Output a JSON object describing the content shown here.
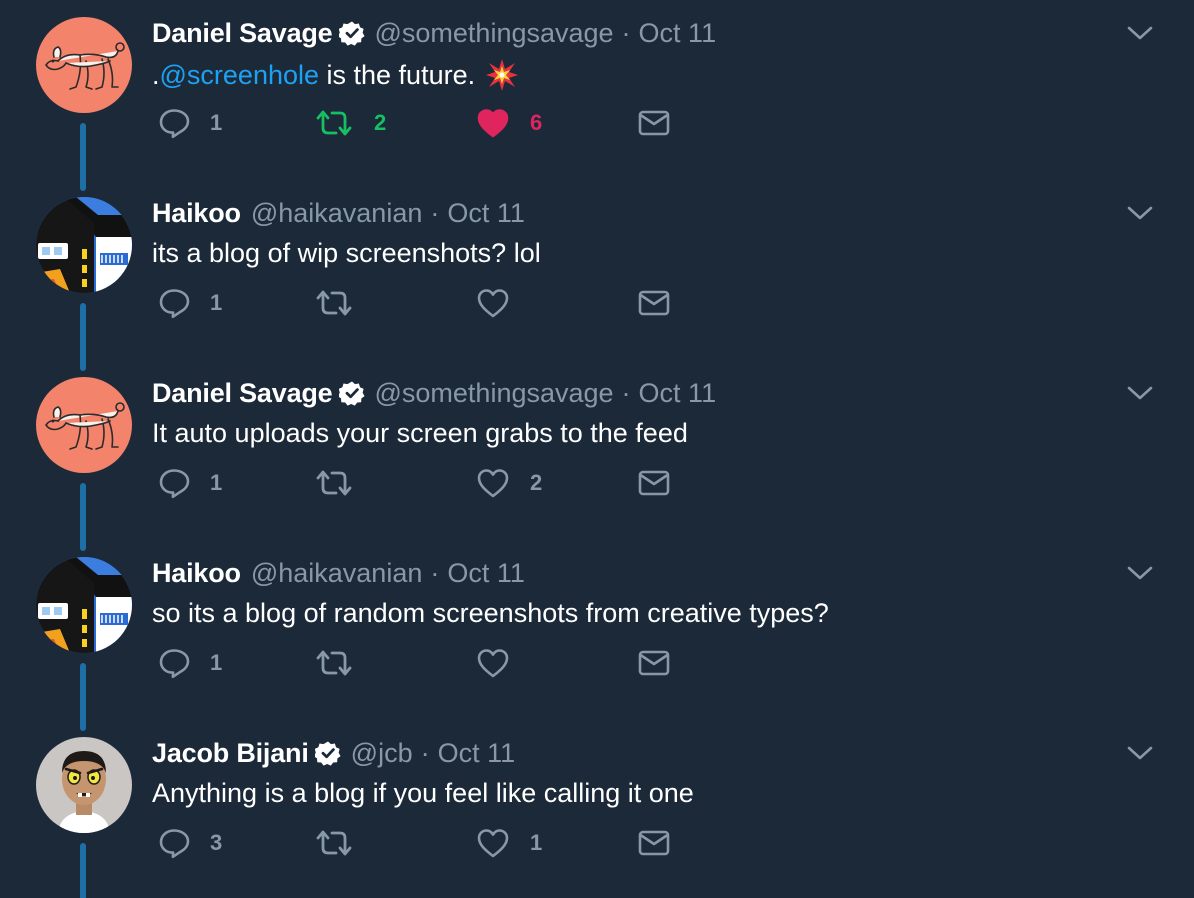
{
  "colors": {
    "background": "#1c2938",
    "accent": "#1da1f2",
    "muted": "#8899a6",
    "retweet_active": "#17bf63",
    "like_active": "#e0245e",
    "thread_line": "#1d6fa5"
  },
  "tweets": [
    {
      "name": "Daniel Savage",
      "verified": true,
      "handle": "@somethingsavage",
      "separator": "·",
      "date": "Oct 11",
      "text_prefix": ".",
      "mention": "@screenhole",
      "text": " is the future.",
      "emoji": "collision-emoji",
      "avatar": "dog-avatar",
      "reply_count": "1",
      "retweet_count": "2",
      "like_count": "6",
      "retweeted": true,
      "liked": true
    },
    {
      "name": "Haikoo",
      "verified": false,
      "handle": "@haikavanian",
      "separator": "·",
      "date": "Oct 11",
      "text": "its a blog of wip screenshots? lol",
      "avatar": "building-avatar",
      "reply_count": "1",
      "retweet_count": "",
      "like_count": ""
    },
    {
      "name": "Daniel Savage",
      "verified": true,
      "handle": "@somethingsavage",
      "separator": "·",
      "date": "Oct 11",
      "text": "It auto uploads your screen grabs to the feed",
      "avatar": "dog-avatar",
      "reply_count": "1",
      "retweet_count": "",
      "like_count": "2"
    },
    {
      "name": "Haikoo",
      "verified": false,
      "handle": "@haikavanian",
      "separator": "·",
      "date": "Oct 11",
      "text": "so its a blog of random screenshots from creative types?",
      "avatar": "building-avatar",
      "reply_count": "1",
      "retweet_count": "",
      "like_count": ""
    },
    {
      "name": "Jacob Bijani",
      "verified": true,
      "handle": "@jcb",
      "separator": "·",
      "date": "Oct 11",
      "text": "Anything is a blog if you feel like calling it one",
      "avatar": "cartoon-man-avatar",
      "reply_count": "3",
      "retweet_count": "",
      "like_count": "1"
    }
  ]
}
